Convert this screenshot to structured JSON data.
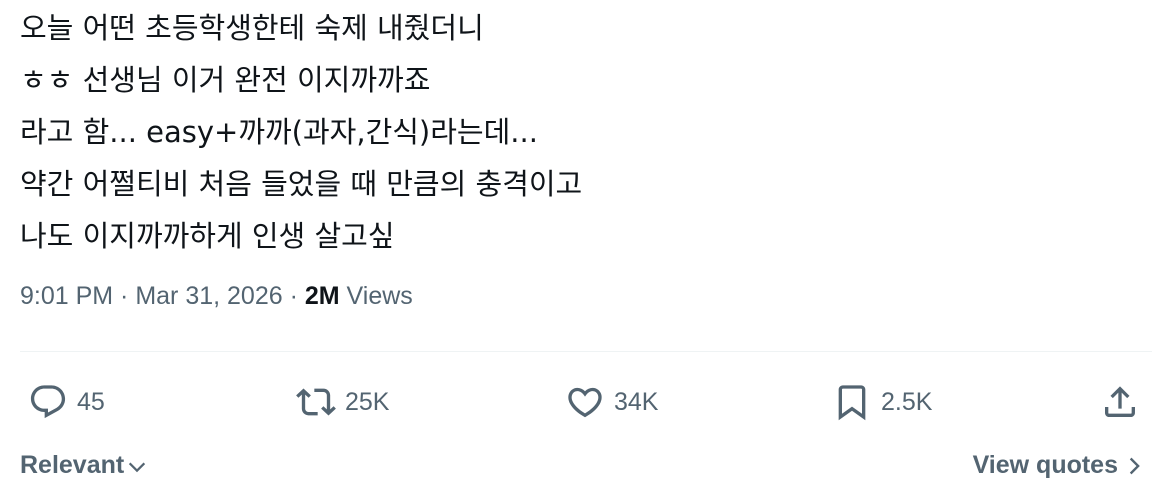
{
  "tweet": {
    "lines": [
      "오늘 어떤 초등학생한테 숙제 내줬더니",
      "ㅎㅎ 선생님 이거 완전 이지까까죠",
      "라고 함... easy+까까(과자,간식)라는데...",
      "약간 어쩔티비 처음 들었을 때 만큼의 충격이고",
      "나도 이지까까하게 인생 살고싶"
    ]
  },
  "meta": {
    "time": "9:01 PM",
    "separator1": " · ",
    "date": "Mar 31, 2026",
    "separator2": " · ",
    "views_count": "2M",
    "views_label": " Views"
  },
  "actions": {
    "reply": {
      "icon": "reply-icon",
      "count": "45"
    },
    "retweet": {
      "icon": "retweet-icon",
      "count": "25K"
    },
    "like": {
      "icon": "heart-icon",
      "count": "34K"
    },
    "bookmark": {
      "icon": "bookmark-icon",
      "count": "2.5K"
    },
    "share": {
      "icon": "share-icon"
    }
  },
  "footer": {
    "sort_label": "Relevant",
    "quotes_label": "View quotes"
  },
  "colors": {
    "text_primary": "#0f1419",
    "text_secondary": "#536471",
    "divider": "#eff3f4"
  }
}
